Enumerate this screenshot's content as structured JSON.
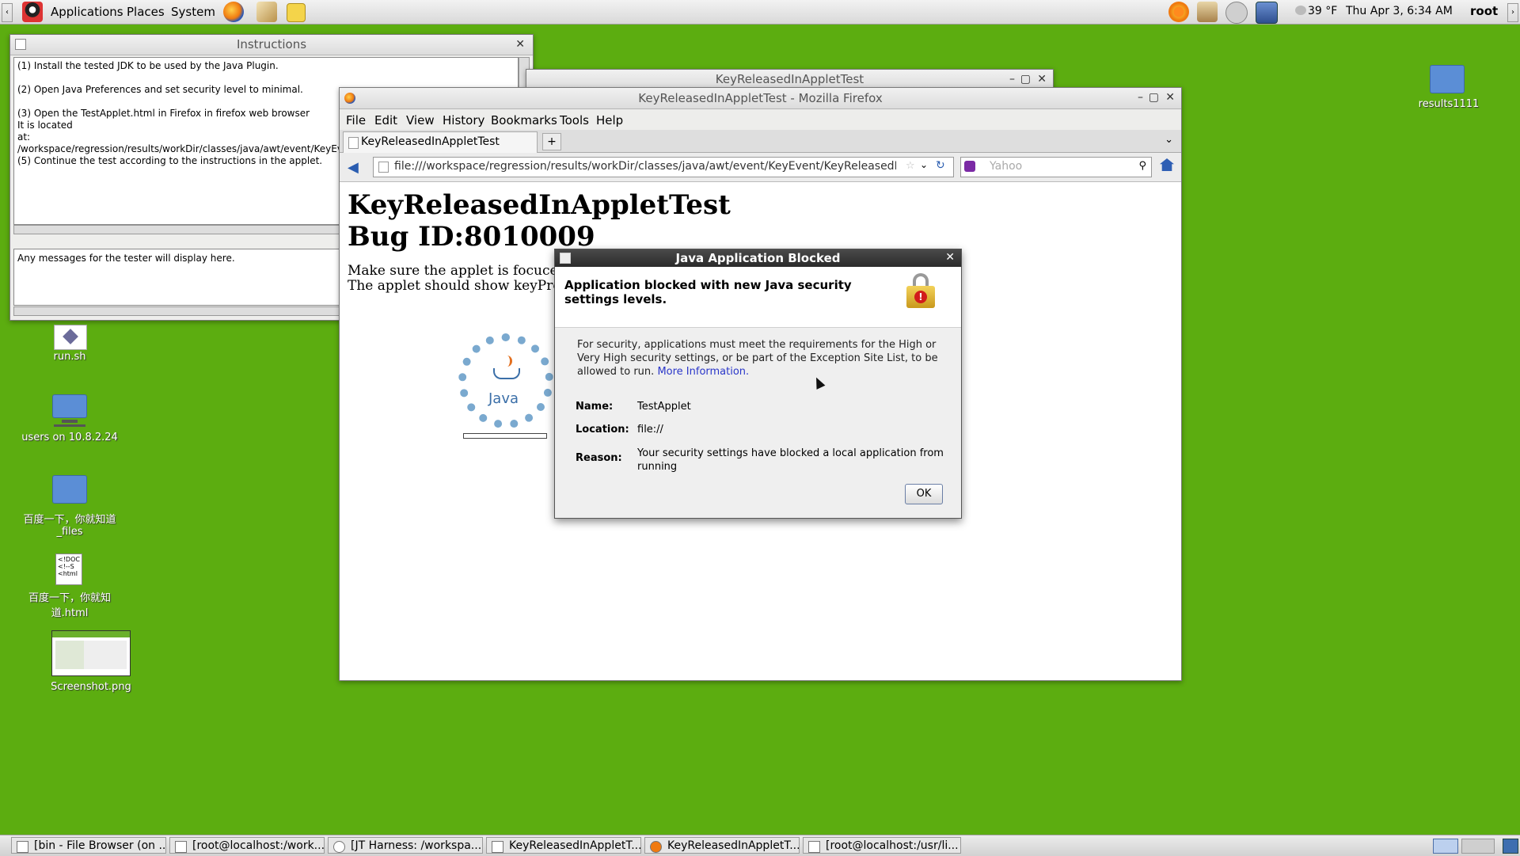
{
  "top_panel": {
    "menus": [
      "Applications",
      "Places",
      "System"
    ],
    "weather": "39 °F",
    "clock": "Thu Apr 3,  6:34 AM",
    "user": "root"
  },
  "desktop_icons": {
    "run_sh": "run.sh",
    "users": "users on 10.8.2.24",
    "baidu_files": "百度一下，你就知道_files",
    "baidu_html": "百度一下，你就知道.html",
    "baidu_html_content": "<!DOC\n<!--S\n<html",
    "screenshot": "Screenshot.png",
    "results": "results1111"
  },
  "instructions_window": {
    "title": "Instructions",
    "lines": [
      "(1) Install the tested JDK to be used by the Java Plugin.",
      "",
      "(2) Open Java Preferences and set security level to minimal.",
      "",
      "(3) Open the TestApplet.html in Firefox in firefox web browser",
      " It is located",
      "at:",
      "/workspace/regression/results/workDir/classes/java/awt/event/KeyEv",
      "(5) Continue the test according to the instructions in the applet."
    ],
    "messages": "Any messages for the tester will display here."
  },
  "back_window": {
    "title": "KeyReleasedInAppletTest"
  },
  "firefox": {
    "title": "KeyReleasedInAppletTest - Mozilla Firefox",
    "menu": [
      "File",
      "Edit",
      "View",
      "History",
      "Bookmarks",
      "Tools",
      "Help"
    ],
    "tab_label": "KeyReleasedInAppletTest",
    "url": "file:///workspace/regression/results/workDir/classes/java/awt/event/KeyEvent/KeyReleasedInApple",
    "search_placeholder": "Yahoo",
    "page_heading_1": "KeyReleasedInAppletTest",
    "page_heading_2": "Bug ID:8010009",
    "page_text_1": "Make sure the applet is focuced",
    "page_text_2": "The applet should show keyPres",
    "java_logo_text": "Java"
  },
  "dialog": {
    "title": "Java Application Blocked",
    "header": "Application blocked with new Java security settings levels.",
    "body": "For security, applications must meet the requirements for the High or Very High security settings, or be part of the Exception Site List, to be allowed to run.",
    "more_info": "More Information.",
    "name_label": "Name:",
    "name_value": "TestApplet",
    "location_label": "Location:",
    "location_value": "file://",
    "reason_label": "Reason:",
    "reason_value": "Your security settings have blocked a local application from running",
    "ok": "OK"
  },
  "taskbar": [
    "[bin - File Browser (on ...",
    "[root@localhost:/work...",
    "[JT Harness: /workspa...",
    "KeyReleasedInAppletT...",
    "KeyReleasedInAppletT...",
    "[root@localhost:/usr/li..."
  ],
  "colors": {
    "desktop": "#5cad10",
    "dialog_title": "#2a2a2a",
    "link": "#2a36c9"
  }
}
